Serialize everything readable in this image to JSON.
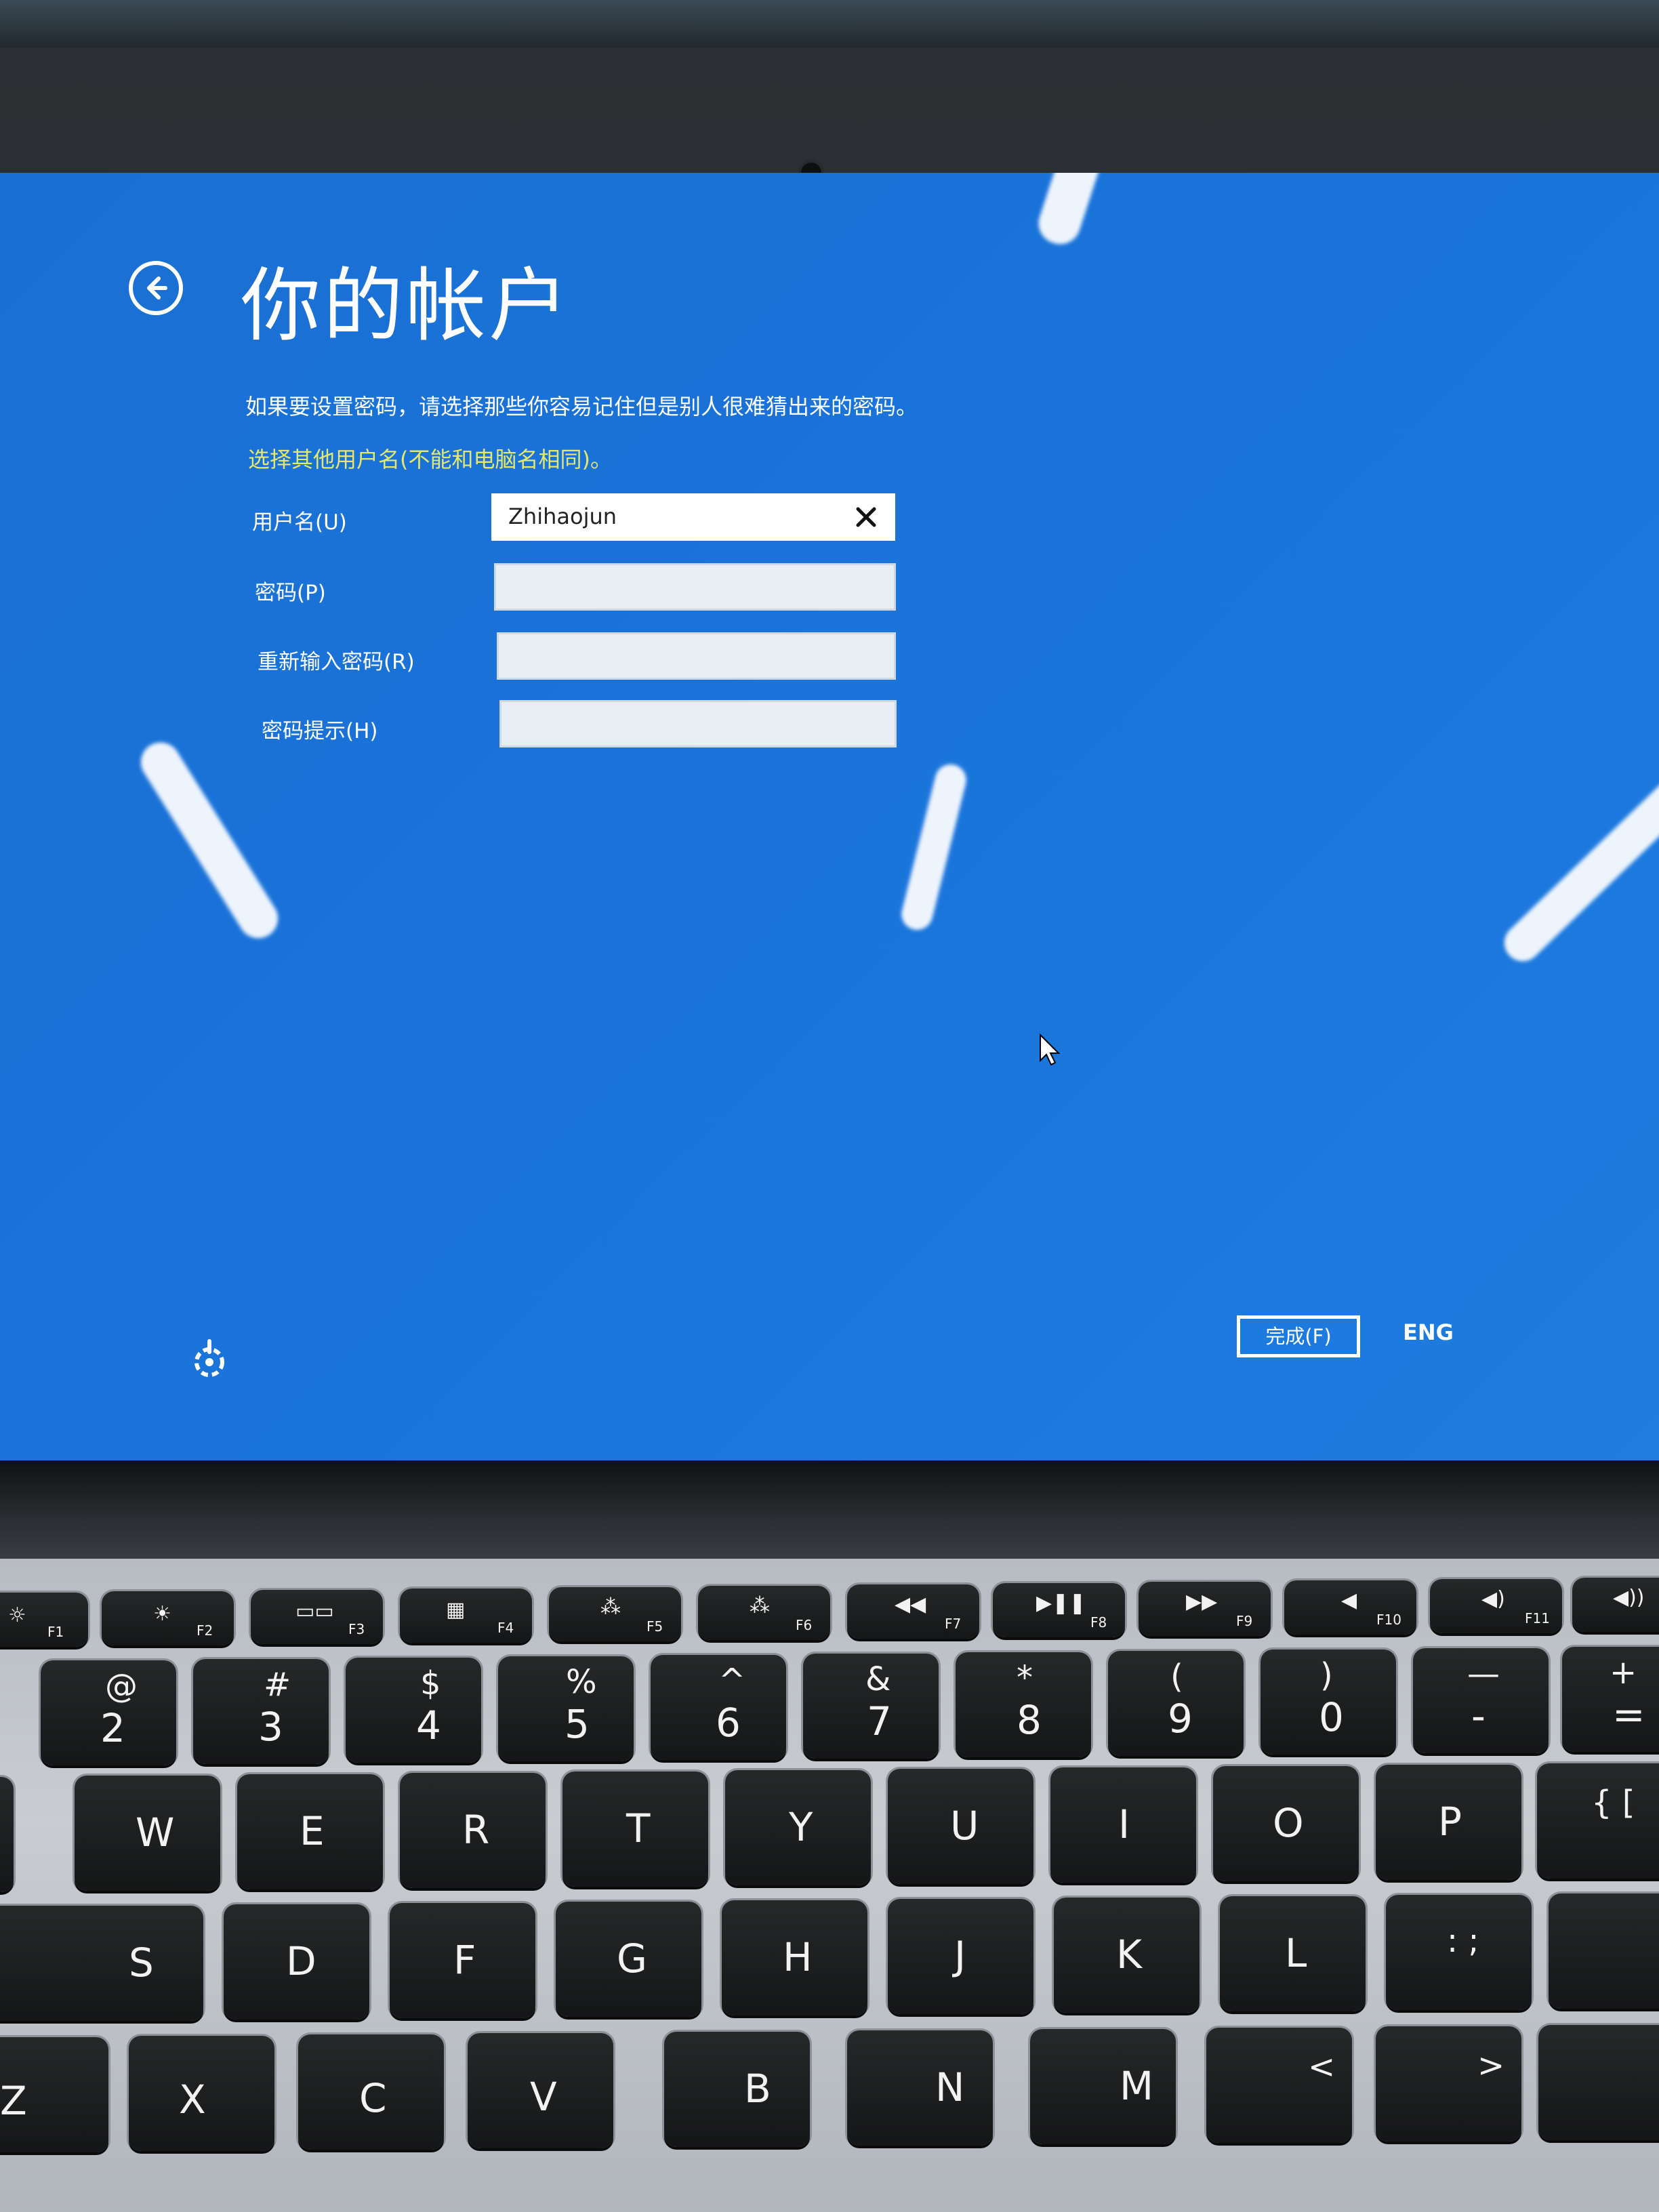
{
  "setup": {
    "title": "你的帐户",
    "description": "如果要设置密码，请选择那些你容易记住但是别人很难猜出来的密码。",
    "warning": "选择其他用户名(不能和电脑名相同)。",
    "warning_color": "#e4e86f",
    "background_color": "#1a73d9",
    "fields": {
      "username": {
        "label": "用户名(U)",
        "value": "Zhihaojun"
      },
      "password": {
        "label": "密码(P)",
        "value": ""
      },
      "password_confirm": {
        "label": "重新输入密码(R)",
        "value": ""
      },
      "password_hint": {
        "label": "密码提示(H)",
        "value": ""
      }
    },
    "finish_button": "完成(F)",
    "language": "ENG",
    "icons": [
      "back-arrow-icon",
      "clear-icon",
      "ease-of-access-icon",
      "mouse-pointer-icon"
    ]
  },
  "keyboard": {
    "function_keys": [
      {
        "fn": "F1",
        "icon": "☼"
      },
      {
        "fn": "F2",
        "icon": "☀"
      },
      {
        "fn": "F3",
        "icon": "▭▭"
      },
      {
        "fn": "F4",
        "icon": "▦"
      },
      {
        "fn": "F5",
        "icon": "⁂"
      },
      {
        "fn": "F6",
        "icon": "⁂"
      },
      {
        "fn": "F7",
        "icon": "◀◀"
      },
      {
        "fn": "F8",
        "icon": "▶❚❚"
      },
      {
        "fn": "F9",
        "icon": "▶▶"
      },
      {
        "fn": "F10",
        "icon": "◀"
      },
      {
        "fn": "F11",
        "icon": "◀)"
      },
      {
        "fn": "",
        "icon": "◀))"
      }
    ],
    "number_row": [
      {
        "top": "@",
        "main": "2"
      },
      {
        "top": "#",
        "main": "3"
      },
      {
        "top": "$",
        "main": "4"
      },
      {
        "top": "%",
        "main": "5"
      },
      {
        "top": "^",
        "main": "6"
      },
      {
        "top": "&",
        "main": "7"
      },
      {
        "top": "*",
        "main": "8"
      },
      {
        "top": "(",
        "main": "9"
      },
      {
        "top": ")",
        "main": "0"
      },
      {
        "top": "—",
        "main": "-"
      },
      {
        "top": "+",
        "main": "="
      }
    ],
    "qwerty_row": [
      "W",
      "E",
      "R",
      "T",
      "Y",
      "U",
      "I",
      "O",
      "P",
      "{ ["
    ],
    "home_row": [
      "S",
      "D",
      "F",
      "G",
      "H",
      "J",
      "K",
      "L",
      ": ;"
    ],
    "bottom_row": [
      "Z",
      "X",
      "C",
      "V",
      "B",
      "N",
      "M",
      "<",
      ">"
    ]
  }
}
